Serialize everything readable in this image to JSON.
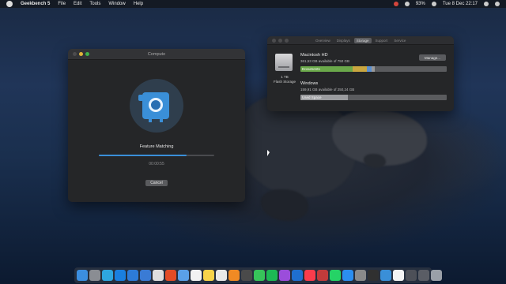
{
  "menubar": {
    "app_name": "Geekbench 5",
    "items": [
      "File",
      "Edit",
      "Tools",
      "Window",
      "Help"
    ],
    "battery": "93%",
    "clock": "Tue 8 Dec  22:17"
  },
  "compute_window": {
    "title": "Compute",
    "benchmark_label": "Feature Matching",
    "progress": 0.76,
    "elapsed": "00:00:55",
    "cancel_label": "Cancel"
  },
  "storage_window": {
    "tabs": [
      "Overview",
      "Displays",
      "Storage",
      "Support",
      "Service"
    ],
    "active_tab": "Storage",
    "disk_capacity": "1 TB",
    "disk_type": "Flash Storage",
    "volumes": [
      {
        "name": "Macintosh HD",
        "available": "361,53 GB available of 750 GB",
        "bar_label": "Documents",
        "button": "Manage..."
      },
      {
        "name": "Windows",
        "available": "159,91 GB available of 250,24 GB",
        "bar_label": "Used Space"
      }
    ]
  },
  "dock": {
    "icons": [
      {
        "name": "finder",
        "color": "#3b8ee0"
      },
      {
        "name": "launchpad",
        "color": "#8a8d93"
      },
      {
        "name": "telegram",
        "color": "#2ea6e0"
      },
      {
        "name": "safari",
        "color": "#1a7fe0"
      },
      {
        "name": "xcode",
        "color": "#2d7bd8"
      },
      {
        "name": "messenger",
        "color": "#3a7bd5"
      },
      {
        "name": "chrome",
        "color": "#dedede"
      },
      {
        "name": "git",
        "color": "#e34c26"
      },
      {
        "name": "mail",
        "color": "#5aa0e8"
      },
      {
        "name": "calendar",
        "color": "#f2f2f2"
      },
      {
        "name": "notes",
        "color": "#f7d34a"
      },
      {
        "name": "photos",
        "color": "#e8e8e8"
      },
      {
        "name": "books",
        "color": "#f08a24"
      },
      {
        "name": "sublime",
        "color": "#4a4a4a"
      },
      {
        "name": "messages",
        "color": "#37c45a"
      },
      {
        "name": "spotify",
        "color": "#1db954"
      },
      {
        "name": "podcasts",
        "color": "#9b4ddb"
      },
      {
        "name": "1password",
        "color": "#1f6fd0"
      },
      {
        "name": "music",
        "color": "#fa3c4c"
      },
      {
        "name": "transmit",
        "color": "#c23b3b"
      },
      {
        "name": "whatsapp",
        "color": "#25d366"
      },
      {
        "name": "app-store",
        "color": "#2b8ef0"
      },
      {
        "name": "settings",
        "color": "#8a8a8a"
      },
      {
        "name": "obs",
        "color": "#303030"
      },
      {
        "name": "geekbench",
        "color": "#3a8fd8"
      },
      {
        "name": "preview",
        "color": "#f4f4f4"
      },
      {
        "name": "downloads",
        "color": "#4d5058"
      },
      {
        "name": "desktop-folder",
        "color": "#5a5d65"
      },
      {
        "name": "trash",
        "color": "#9aa0a8"
      }
    ]
  },
  "colors": {
    "accent": "#3a8fd8",
    "documents_seg": "#6aa84a",
    "other_seg": "#c9a640"
  }
}
